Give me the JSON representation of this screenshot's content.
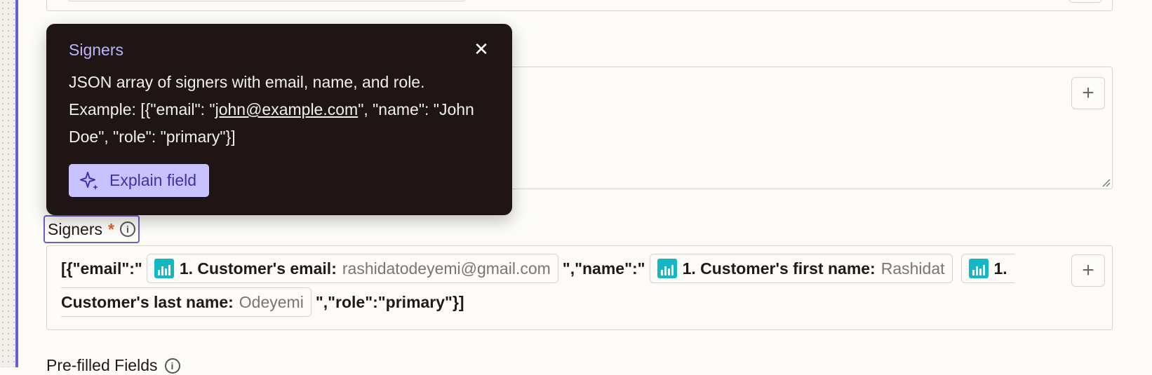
{
  "tooltip": {
    "title": "Signers",
    "body_prefix": "JSON array of signers with email, name, and role. Example: [{\"email\": \"",
    "body_link": "john@example.com",
    "body_suffix": "\", \"name\": \"John Doe\", \"role\": \"primary\"}]",
    "explain_label": "Explain field",
    "close_icon": "close-icon"
  },
  "signers_field": {
    "label": "Signers",
    "required_mark": "*",
    "tokens": {
      "text1": "[{\"email\":\"",
      "email_key": "1. Customer's email:",
      "email_value": "rashidatodeyemi@gmail.com",
      "text2": "\",\"name\":\"",
      "first_key": "1. Customer's first name:",
      "first_value": "Rashidat",
      "last_key_part1": "1.",
      "last_key_part2": "Customer's last name:",
      "last_value": "Odeyemi",
      "text3": "\",\"role\":\"primary\"}]"
    }
  },
  "next_section": {
    "label": "Pre-filled Fields"
  },
  "colors": {
    "accent": "#6a5fd0",
    "tooltip_bg": "#1e1514",
    "required": "#e8621f",
    "app_icon": "#13b8c2"
  }
}
